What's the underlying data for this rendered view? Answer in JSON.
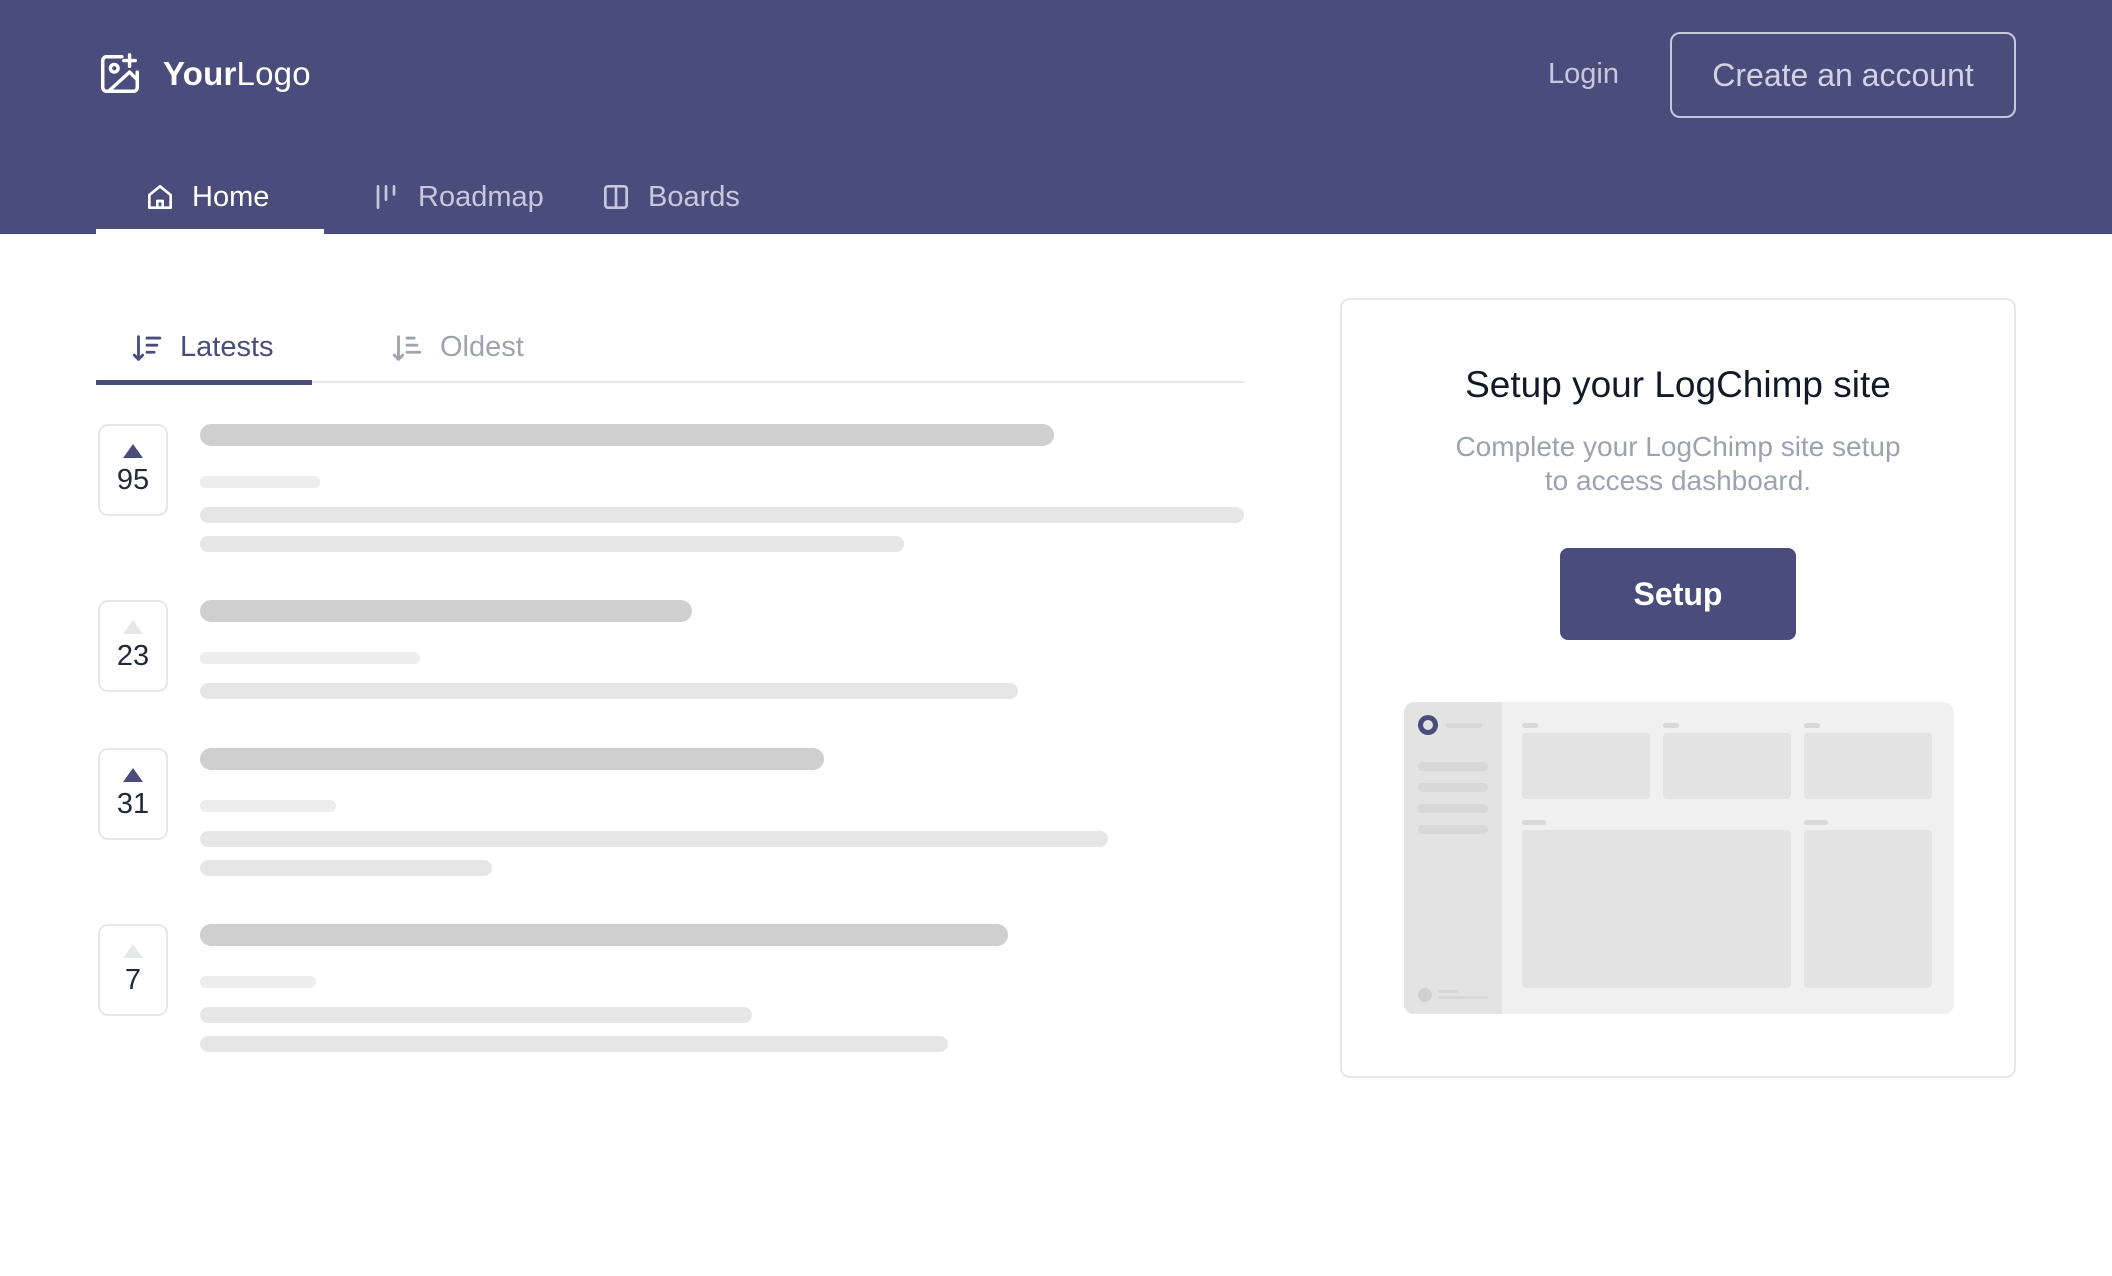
{
  "brand": {
    "bold": "Your",
    "light": "Logo",
    "icon": "image-plus-icon"
  },
  "auth": {
    "login_label": "Login",
    "create_account_label": "Create an account"
  },
  "nav": {
    "tabs": [
      {
        "label": "Home",
        "icon": "home-icon",
        "active": true
      },
      {
        "label": "Roadmap",
        "icon": "roadmap-icon",
        "active": false
      },
      {
        "label": "Boards",
        "icon": "boards-icon",
        "active": false
      }
    ]
  },
  "sort": {
    "tabs": [
      {
        "label": "Latests",
        "icon": "sort-descending-icon",
        "active": true
      },
      {
        "label": "Oldest",
        "icon": "sort-ascending-icon",
        "active": false
      }
    ]
  },
  "posts": [
    {
      "votes": "95",
      "voted": true
    },
    {
      "votes": "23",
      "voted": false
    },
    {
      "votes": "31",
      "voted": true
    },
    {
      "votes": "7",
      "voted": false
    }
  ],
  "setup_card": {
    "title": "Setup your LogChimp site",
    "subtitle": "Complete your LogChimp site setup to access dashboard.",
    "button_label": "Setup"
  },
  "colors": {
    "brand": "#4a4d7b",
    "white": "#ffffff",
    "muted": "#9ca3af"
  }
}
